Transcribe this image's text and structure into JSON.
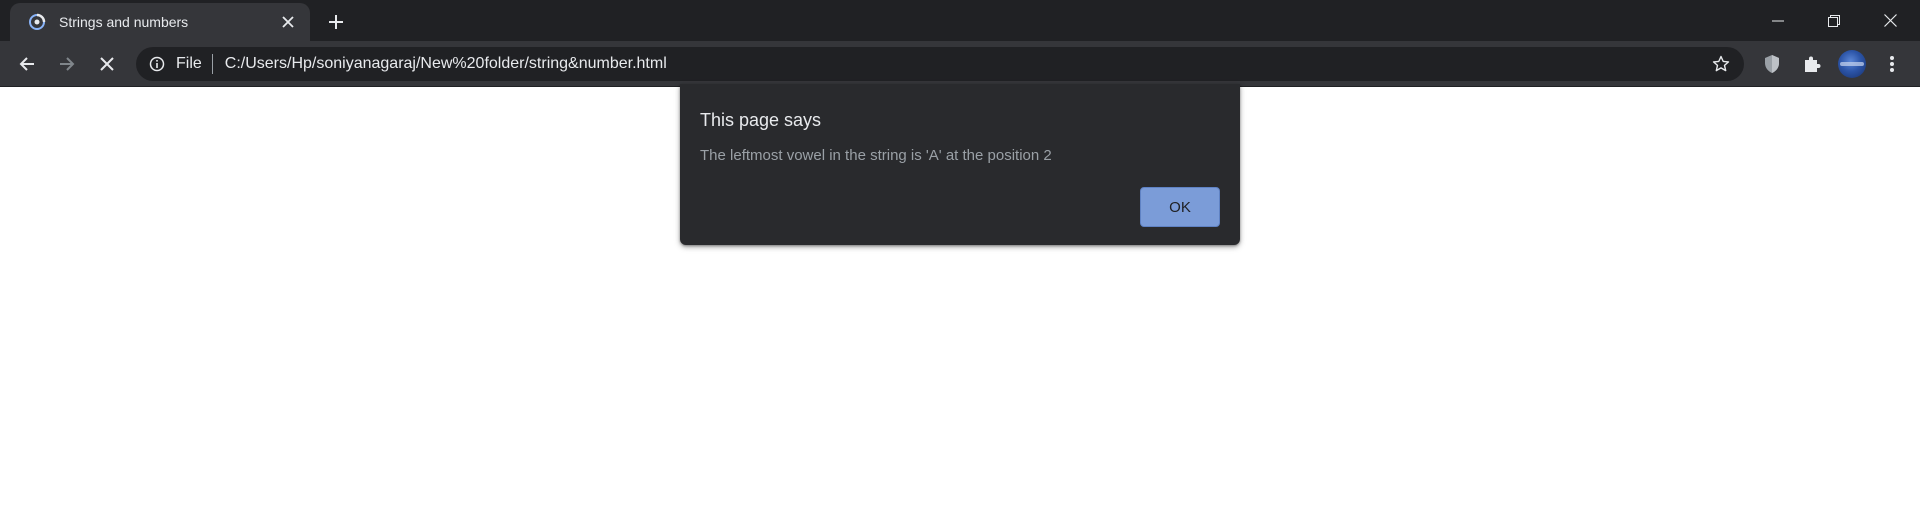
{
  "tab": {
    "title": "Strings and numbers",
    "favicon": "loading-spinner-icon",
    "close_icon": "close-icon"
  },
  "new_tab_icon": "plus-icon",
  "window_controls": [
    "minimize-icon",
    "restore-icon",
    "close-icon"
  ],
  "toolbar": {
    "back_icon": "arrow-left-icon",
    "forward_icon": "arrow-right-icon",
    "stop_icon": "stop-loading-icon",
    "scheme_label": "File",
    "url": "C:/Users/Hp/soniyanagaraj/New%20folder/string&number.html",
    "bookmark_icon": "star-icon",
    "extension_shield_icon": "shield-icon",
    "extensions_icon": "puzzle-icon",
    "profile_icon": "avatar",
    "menu_icon": "kebab-menu-icon"
  },
  "dialog": {
    "title": "This page says",
    "message": "The leftmost vowel in the string is 'A' at the position 2",
    "ok_label": "OK"
  },
  "colors": {
    "tabstrip_bg": "#202124",
    "toolbar_bg": "#35363a",
    "omnibox_bg": "#202124",
    "dialog_bg": "#292a2d",
    "ok_button_bg": "#7b9cd8",
    "page_bg": "#ffffff"
  }
}
